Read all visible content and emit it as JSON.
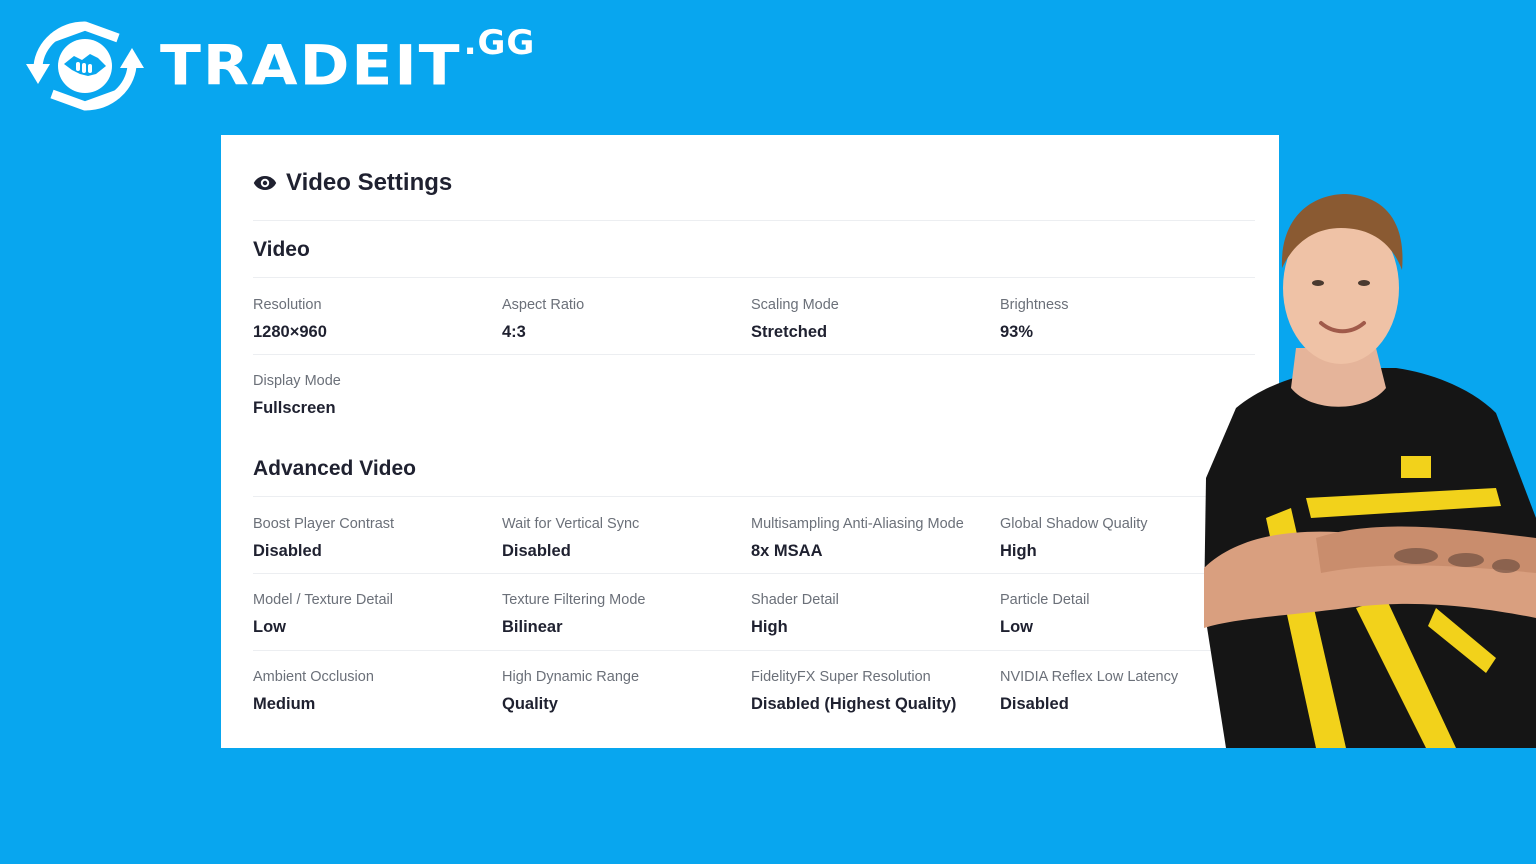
{
  "brand": {
    "name": "TRADEIT",
    "suffix": ".GG",
    "logo_icon": "handshake-icon"
  },
  "card": {
    "title": "Video Settings",
    "title_icon": "eye-icon",
    "sections": [
      {
        "heading": "Video",
        "rows": [
          [
            {
              "label": "Resolution",
              "value": "1280×960"
            },
            {
              "label": "Aspect Ratio",
              "value": "4:3"
            },
            {
              "label": "Scaling Mode",
              "value": "Stretched"
            },
            {
              "label": "Brightness",
              "value": "93%"
            }
          ],
          [
            {
              "label": "Display Mode",
              "value": "Fullscreen"
            }
          ]
        ]
      },
      {
        "heading": "Advanced Video",
        "rows": [
          [
            {
              "label": "Boost Player Contrast",
              "value": "Disabled"
            },
            {
              "label": "Wait for Vertical Sync",
              "value": "Disabled"
            },
            {
              "label": "Multisampling Anti-Aliasing Mode",
              "value": "8x MSAA"
            },
            {
              "label": "Global Shadow Quality",
              "value": "High"
            }
          ],
          [
            {
              "label": "Model / Texture Detail",
              "value": "Low"
            },
            {
              "label": "Texture Filtering Mode",
              "value": "Bilinear"
            },
            {
              "label": "Shader Detail",
              "value": "High"
            },
            {
              "label": "Particle Detail",
              "value": "Low"
            }
          ],
          [
            {
              "label": "Ambient Occlusion",
              "value": "Medium"
            },
            {
              "label": "High Dynamic Range",
              "value": "Quality"
            },
            {
              "label": "FidelityFX Super Resolution",
              "value": "Disabled (Highest Quality)"
            },
            {
              "label": "NVIDIA Reflex Low Latency",
              "value": "Disabled"
            }
          ]
        ]
      }
    ]
  },
  "colors": {
    "background": "#08a6ef",
    "card": "#ffffff",
    "text_primary": "#1f2130",
    "text_secondary": "#6b7079",
    "jersey_yellow": "#f2d21b"
  }
}
